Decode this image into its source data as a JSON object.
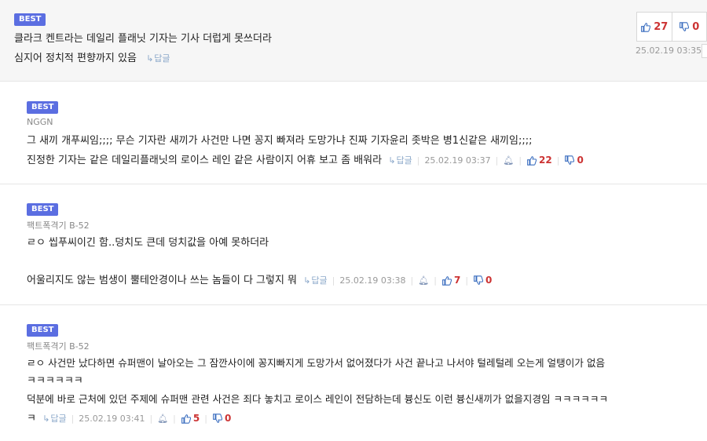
{
  "comments": [
    {
      "badge": "BEST",
      "line1": "클라크 켄트라는 데일리 플래닛 기자는 기사 더럽게 못쓰더라",
      "line2": "심지어 정치적 편향까지 있음",
      "reply": "답글",
      "time": "25.02.19 03:35",
      "up": "27",
      "down": "0"
    },
    {
      "badge": "BEST",
      "author": "NGGN",
      "line1": "그 새끼 개푸씨임;;;; 무슨 기자란 새끼가 사건만 나면 꽁지 빠져라 도망가냐 진짜 기자윤리 좃박은 병1신같은 새끼임;;;;",
      "line2": "진정한 기자는 같은 데일리플래닛의 로이스 레인 같은 사람이지 어휴 보고 좀 배워라",
      "reply": "답글",
      "time": "25.02.19 03:37",
      "up": "22",
      "down": "0"
    },
    {
      "badge": "BEST",
      "author": "팩트폭격기 B-52",
      "line1": "ㄹㅇ 씹푸씨이긴 함..덩치도 큰데 덩치값을 아예 못하더라",
      "line2": "어울리지도 않는 범생이 뿔테안경이나 쓰는 놈들이 다 그렇지 뭐",
      "reply": "답글",
      "time": "25.02.19 03:38",
      "up": "7",
      "down": "0"
    },
    {
      "badge": "BEST",
      "author": "팩트폭격기 B-52",
      "line1": "ㄹㅇ 사건만 났다하면 슈퍼맨이 날아오는 그 잠깐사이에 꽁지빠지게 도망가서 없어졌다가 사건 끝나고 나서야 털레털레 오는게 얼탱이가 없음",
      "line2": "ㅋㅋㅋㅋㅋㅋ",
      "line3": "덕분에 바로 근처에 있던 주제에 슈퍼맨 관련 사건은 죄다 놓치고 로이스 레인이 전담하는데 븅신도 이런 븅신새끼가 없을지경임 ㅋㅋㅋㅋㅋㅋ",
      "line4": "ㅋ",
      "reply": "답글",
      "time": "25.02.19 03:41",
      "up": "5",
      "down": "0"
    }
  ],
  "icons": {
    "thumbs_up": "thumbs-up-icon",
    "thumbs_down": "thumbs-down-icon",
    "report": "bell-icon",
    "reply_arrow": "reply-arrow-icon"
  },
  "colors": {
    "badge": "#5b6ee1",
    "count": "#cc3333",
    "reply": "#8aa7c9",
    "thumb": "#3a6dbf"
  }
}
